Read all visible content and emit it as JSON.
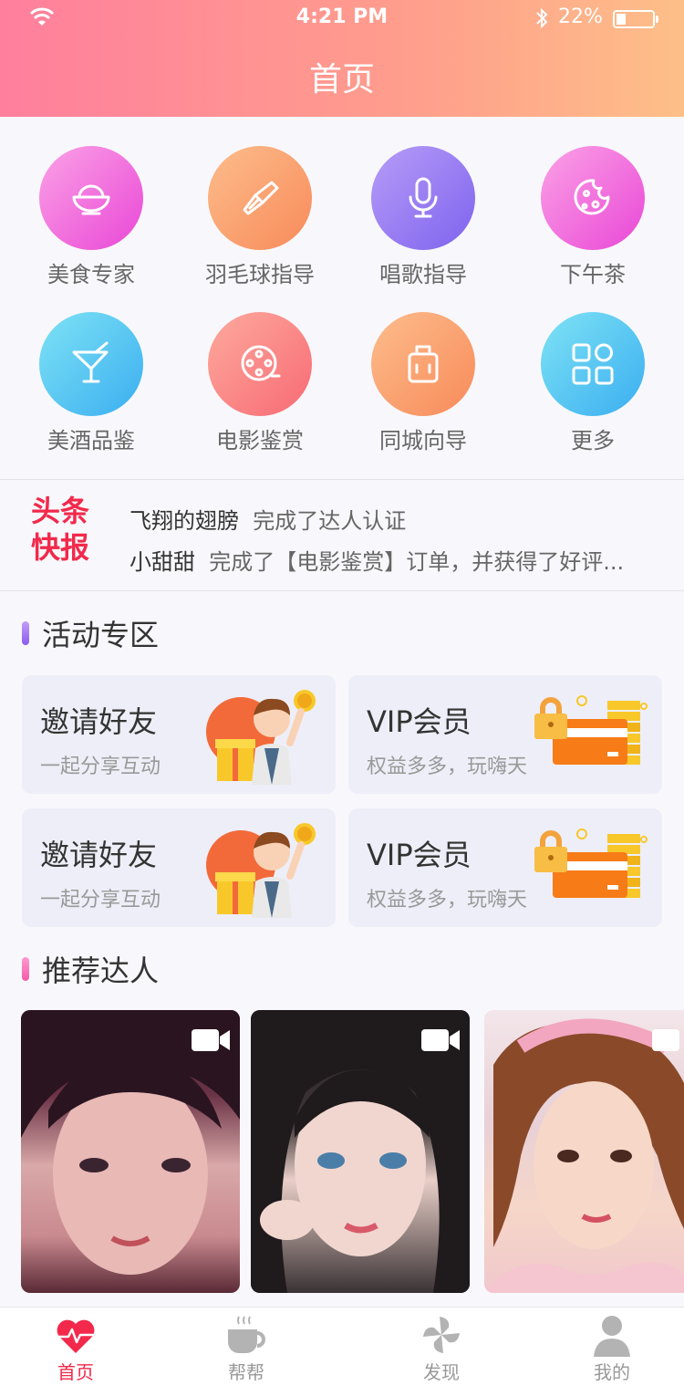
{
  "status_bar": {
    "time": "4:21 PM",
    "battery": "22%"
  },
  "header": {
    "title": "首页"
  },
  "categories": [
    {
      "label": "美食专家",
      "icon": "rice-bowl-icon"
    },
    {
      "label": "羽毛球指导",
      "icon": "shuttlecock-icon"
    },
    {
      "label": "唱歌指导",
      "icon": "microphone-icon"
    },
    {
      "label": "下午茶",
      "icon": "cookie-icon"
    },
    {
      "label": "美酒品鉴",
      "icon": "cocktail-icon"
    },
    {
      "label": "电影鉴赏",
      "icon": "film-reel-icon"
    },
    {
      "label": "同城向导",
      "icon": "luggage-icon"
    },
    {
      "label": "更多",
      "icon": "grid-icon"
    }
  ],
  "news": {
    "logo_line1": "头条",
    "logo_line2": "快报",
    "items": [
      {
        "name": "飞翔的翅膀",
        "text": "完成了达人认证"
      },
      {
        "name": "小甜甜",
        "text": "完成了【电影鉴赏】订单，并获得了好评..."
      }
    ]
  },
  "sections": {
    "activity": "活动专区",
    "talent": "推荐达人"
  },
  "cards": [
    {
      "title": "邀请好友",
      "subtitle": "一起分享互动",
      "art": "invite-friends-illustration"
    },
    {
      "title": "VIP会员",
      "subtitle": "权益多多，玩嗨天",
      "art": "vip-card-illustration"
    },
    {
      "title": "邀请好友",
      "subtitle": "一起分享互动",
      "art": "invite-friends-illustration"
    },
    {
      "title": "VIP会员",
      "subtitle": "权益多多，玩嗨天",
      "art": "vip-card-illustration"
    }
  ],
  "tabs": [
    {
      "label": "首页",
      "icon": "heart-pulse-icon",
      "active": true
    },
    {
      "label": "帮帮",
      "icon": "coffee-cup-icon",
      "active": false
    },
    {
      "label": "发现",
      "icon": "pinwheel-icon",
      "active": false
    },
    {
      "label": "我的",
      "icon": "person-icon",
      "active": false
    }
  ],
  "colors": {
    "accent": "#f2294b",
    "background": "#f8f8fc",
    "title_text": "#333333",
    "body_text": "#666666"
  }
}
